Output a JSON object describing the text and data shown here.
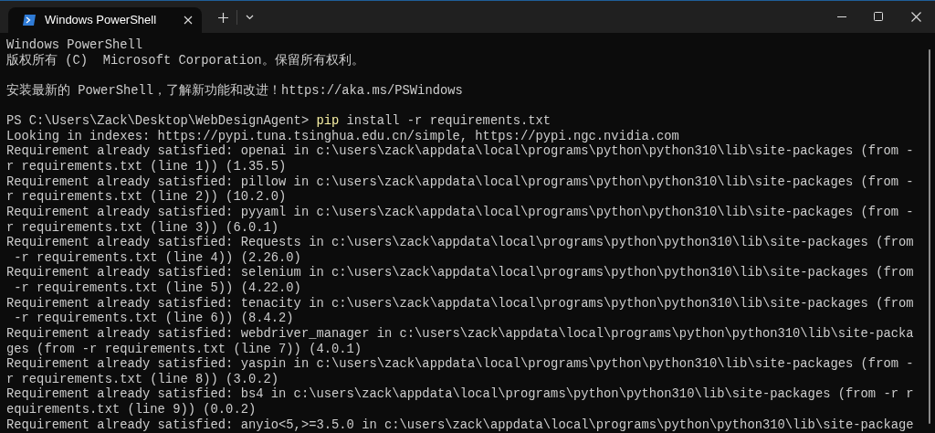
{
  "tabs": [
    {
      "title": "Windows PowerShell",
      "selected": true
    }
  ],
  "terminal": {
    "lines": [
      {
        "kind": "text",
        "text": "Windows PowerShell"
      },
      {
        "kind": "text",
        "text": "版权所有 (C)  Microsoft Corporation。保留所有权利。"
      },
      {
        "kind": "blank"
      },
      {
        "kind": "text",
        "text": "安装最新的 PowerShell，了解新功能和改进！https://aka.ms/PSWindows"
      },
      {
        "kind": "blank"
      },
      {
        "kind": "input",
        "segments": [
          {
            "kind": "prompt",
            "text": "PS C:\\Users\\Zack\\Desktop\\WebDesignAgent> "
          },
          {
            "kind": "command",
            "text": "pip"
          },
          {
            "kind": "argument",
            "text": " install -r requirements.txt"
          }
        ]
      },
      {
        "kind": "text",
        "text": "Looking in indexes: https://pypi.tuna.tsinghua.edu.cn/simple, https://pypi.ngc.nvidia.com"
      },
      {
        "kind": "text",
        "text": "Requirement already satisfied: openai in c:\\users\\zack\\appdata\\local\\programs\\python\\python310\\lib\\site-packages (from -"
      },
      {
        "kind": "text",
        "text": "r requirements.txt (line 1)) (1.35.5)"
      },
      {
        "kind": "text",
        "text": "Requirement already satisfied: pillow in c:\\users\\zack\\appdata\\local\\programs\\python\\python310\\lib\\site-packages (from -"
      },
      {
        "kind": "text",
        "text": "r requirements.txt (line 2)) (10.2.0)"
      },
      {
        "kind": "text",
        "text": "Requirement already satisfied: pyyaml in c:\\users\\zack\\appdata\\local\\programs\\python\\python310\\lib\\site-packages (from -"
      },
      {
        "kind": "text",
        "text": "r requirements.txt (line 3)) (6.0.1)"
      },
      {
        "kind": "text",
        "text": "Requirement already satisfied: Requests in c:\\users\\zack\\appdata\\local\\programs\\python\\python310\\lib\\site-packages (from"
      },
      {
        "kind": "text",
        "text": " -r requirements.txt (line 4)) (2.26.0)"
      },
      {
        "kind": "text",
        "text": "Requirement already satisfied: selenium in c:\\users\\zack\\appdata\\local\\programs\\python\\python310\\lib\\site-packages (from"
      },
      {
        "kind": "text",
        "text": " -r requirements.txt (line 5)) (4.22.0)"
      },
      {
        "kind": "text",
        "text": "Requirement already satisfied: tenacity in c:\\users\\zack\\appdata\\local\\programs\\python\\python310\\lib\\site-packages (from"
      },
      {
        "kind": "text",
        "text": " -r requirements.txt (line 6)) (8.4.2)"
      },
      {
        "kind": "text",
        "text": "Requirement already satisfied: webdriver_manager in c:\\users\\zack\\appdata\\local\\programs\\python\\python310\\lib\\site-packa"
      },
      {
        "kind": "text",
        "text": "ges (from -r requirements.txt (line 7)) (4.0.1)"
      },
      {
        "kind": "text",
        "text": "Requirement already satisfied: yaspin in c:\\users\\zack\\appdata\\local\\programs\\python\\python310\\lib\\site-packages (from -"
      },
      {
        "kind": "text",
        "text": "r requirements.txt (line 8)) (3.0.2)"
      },
      {
        "kind": "text",
        "text": "Requirement already satisfied: bs4 in c:\\users\\zack\\appdata\\local\\programs\\python\\python310\\lib\\site-packages (from -r r"
      },
      {
        "kind": "text",
        "text": "equirements.txt (line 9)) (0.0.2)"
      },
      {
        "kind": "text",
        "text": "Requirement already satisfied: anyio<5,>=3.5.0 in c:\\users\\zack\\appdata\\local\\programs\\python\\python310\\lib\\site-package"
      }
    ]
  }
}
